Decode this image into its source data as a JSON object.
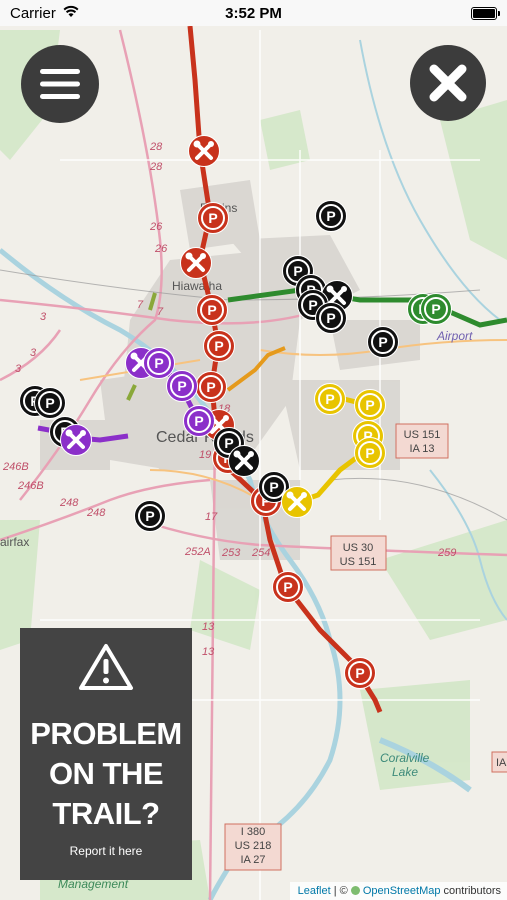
{
  "status_bar": {
    "carrier": "Carrier",
    "time": "3:52 PM"
  },
  "controls": {
    "menu_icon": "hamburger-menu-icon",
    "close_icon": "close-x-icon"
  },
  "problem_panel": {
    "icon": "warning-triangle-icon",
    "title": "PROBLEM\nON THE\nTRAIL?",
    "link": "Report it here"
  },
  "attribution": {
    "leaflet": "Leaflet",
    "separator": " | © ",
    "osm": "OpenStreetMap",
    "contributors": " contributors"
  },
  "map_labels": {
    "town_north": "Robins",
    "town_hiawatha": "Hiawatha",
    "city": "Cedar Rapids",
    "airport": "Airport",
    "fairfax": "airfax",
    "coralville_1": "Coralville",
    "coralville_2": "Lake",
    "management": "Management"
  },
  "road_labels": {
    "r28a": "28",
    "r28b": "28",
    "r26a": "26",
    "r26b": "26",
    "r7a": "7",
    "r7b": "7",
    "r3a": "3",
    "r3b": "3",
    "r3c": "3",
    "r246a": "246B",
    "r246b": "246B",
    "r248a": "248",
    "r248b": "248",
    "r252": "252A",
    "r253": "253",
    "r254": "254",
    "r259": "259",
    "r13a": "13",
    "r13b": "13",
    "r17": "17",
    "r18": "18",
    "r19": "19"
  },
  "route_shields": {
    "us151_ia13": [
      "US 151",
      "IA 13"
    ],
    "us30_us151": [
      "US 30",
      "US 151"
    ],
    "i380": [
      "I 380",
      "US 218",
      "IA 27"
    ],
    "edge": "IA"
  },
  "legend_colors": {
    "red_trail": "#c8321c",
    "green_trail": "#2e8b2e",
    "purple_trail": "#8b2fc9",
    "yellow_trail": "#e8c400",
    "orange_trail": "#e59a1c",
    "parking_black": "#111111",
    "panel_bg": "#444444"
  },
  "marker_icons": {
    "parking": "parking-icon",
    "repair": "repair-tools-icon"
  }
}
